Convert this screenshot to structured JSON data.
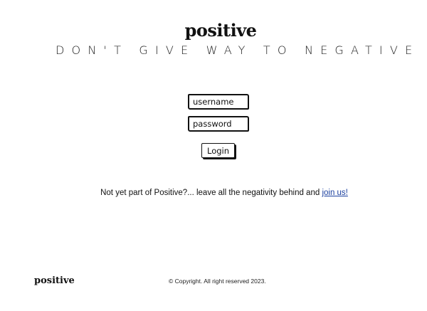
{
  "header": {
    "brand": "positive",
    "tagline": "DON'T GIVE WAY TO NEGATIVE"
  },
  "login_form": {
    "username_placeholder": "username",
    "password_placeholder": "password",
    "username_value": "",
    "password_value": "",
    "login_label": "Login"
  },
  "signup_prompt": {
    "text": "Not yet part of Positive?... leave all the negativity behind and ",
    "link_label": "join us!",
    "link_color": "#1a3f9e"
  },
  "footer": {
    "logo": "positive",
    "copyright": "© Copyright. All right reserved 2023."
  }
}
